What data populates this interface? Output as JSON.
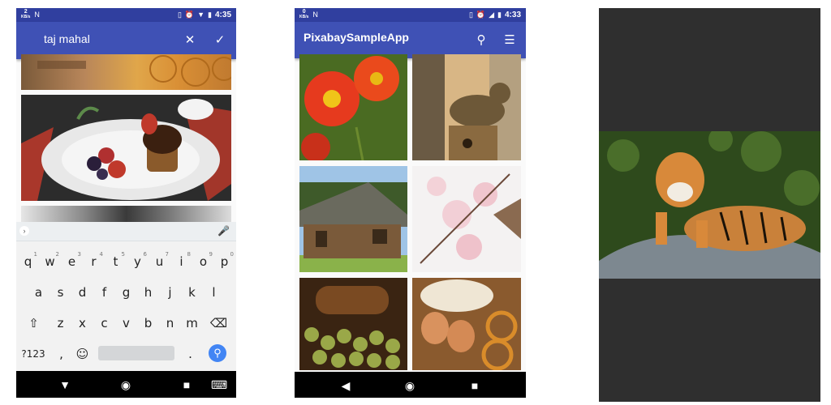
{
  "phone1": {
    "status": {
      "speed_top": "2",
      "speed_bottom": "KB/s",
      "time": "4:35"
    },
    "search": {
      "query": "taj mahal"
    },
    "keyboard": {
      "row1": [
        {
          "k": "q",
          "n": "1"
        },
        {
          "k": "w",
          "n": "2"
        },
        {
          "k": "e",
          "n": "3"
        },
        {
          "k": "r",
          "n": "4"
        },
        {
          "k": "t",
          "n": "5"
        },
        {
          "k": "y",
          "n": "6"
        },
        {
          "k": "u",
          "n": "7"
        },
        {
          "k": "i",
          "n": "8"
        },
        {
          "k": "o",
          "n": "9"
        },
        {
          "k": "p",
          "n": "0"
        }
      ],
      "row2": [
        "a",
        "s",
        "d",
        "f",
        "g",
        "h",
        "j",
        "k",
        "l"
      ],
      "row3": [
        "z",
        "x",
        "c",
        "v",
        "b",
        "n",
        "m"
      ],
      "sym_label": "?123",
      "comma": ",",
      "period": "."
    }
  },
  "phone2": {
    "status": {
      "speed_top": "0",
      "speed_bottom": "KB/s",
      "time": "4:33"
    },
    "app_title": "PixabaySampleApp"
  },
  "icons": {
    "clear": "close-icon",
    "confirm": "check-icon",
    "search": "search-icon",
    "menu": "menu-icon"
  },
  "colors": {
    "primary": "#3f51b5",
    "primary_dark": "#303f9f",
    "keyboard_action": "#4285f4"
  }
}
